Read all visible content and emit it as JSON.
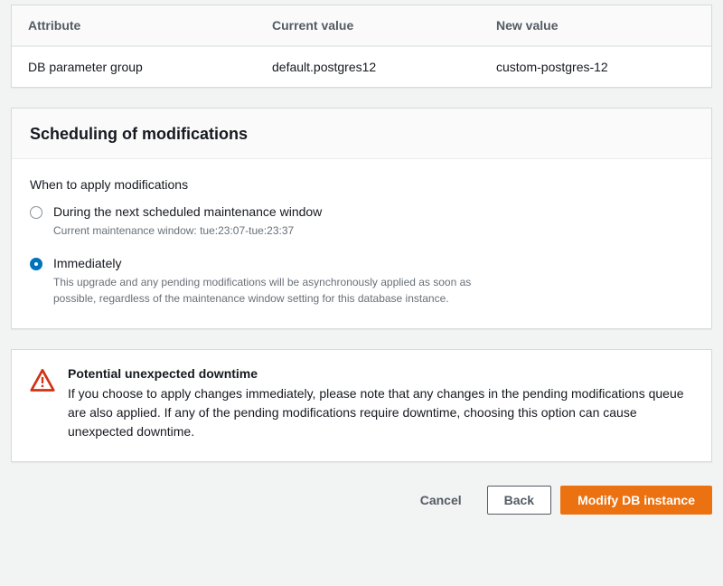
{
  "summary_table": {
    "headers": {
      "attribute": "Attribute",
      "current": "Current value",
      "new": "New value"
    },
    "row": {
      "attribute": "DB parameter group",
      "current": "default.postgres12",
      "new": "custom-postgres-12"
    }
  },
  "scheduling": {
    "heading": "Scheduling of modifications",
    "prompt": "When to apply modifications",
    "options": [
      {
        "label": "During the next scheduled maintenance window",
        "desc": "Current maintenance window: tue:23:07-tue:23:37",
        "selected": false
      },
      {
        "label": "Immediately",
        "desc": "This upgrade and any pending modifications will be asynchronously applied as soon as possible, regardless of the maintenance window setting for this database instance.",
        "selected": true
      }
    ]
  },
  "warning": {
    "title": "Potential unexpected downtime",
    "text": "If you choose to apply changes immediately, please note that any changes in the pending modifications queue are also applied. If any of the pending modifications require downtime, choosing this option can cause unexpected downtime."
  },
  "footer": {
    "cancel": "Cancel",
    "back": "Back",
    "submit": "Modify DB instance"
  }
}
